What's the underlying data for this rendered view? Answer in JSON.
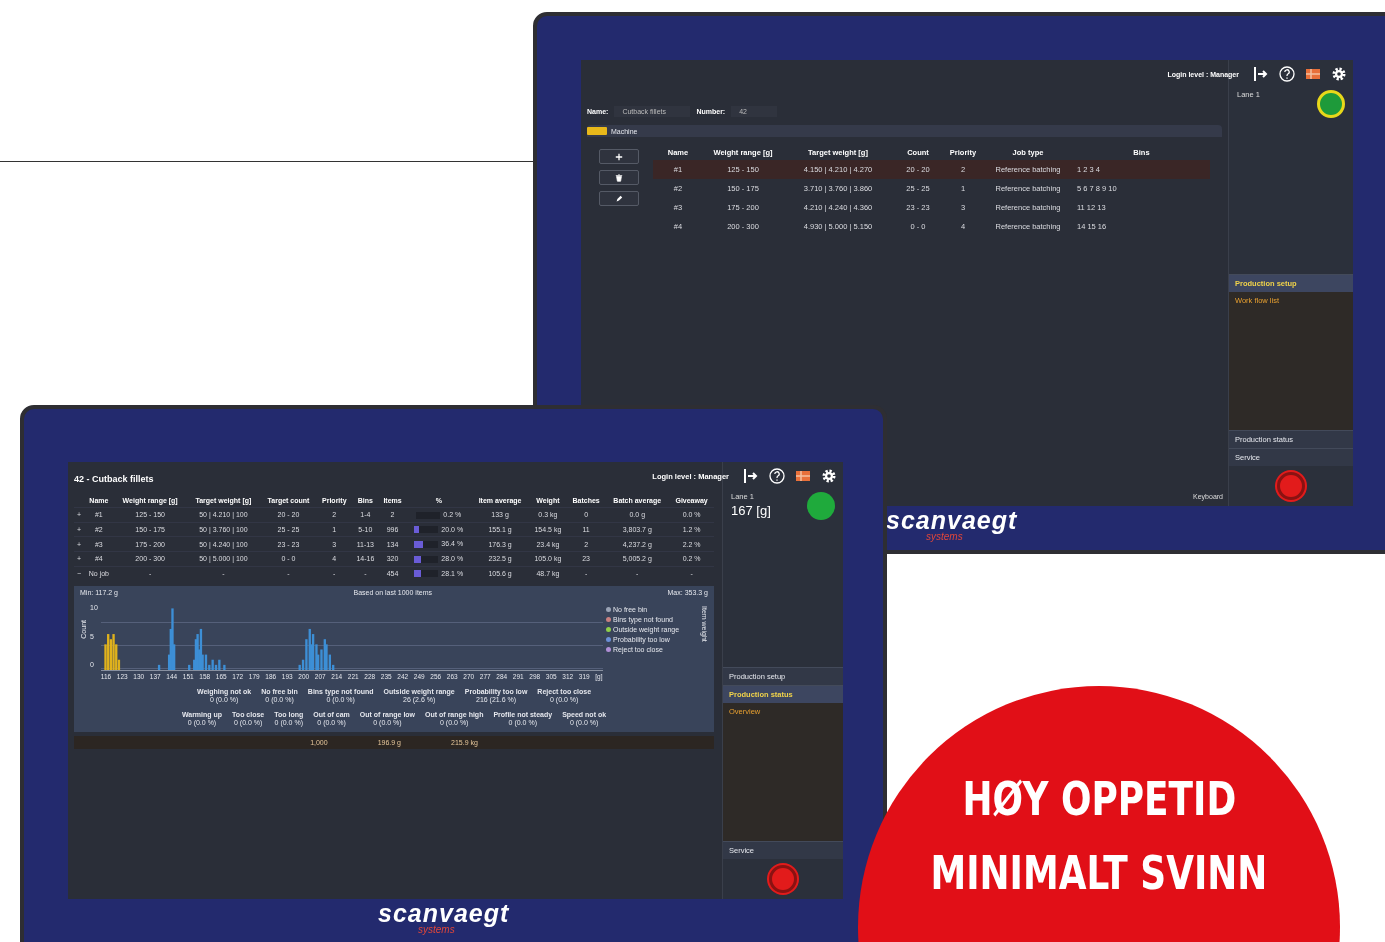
{
  "back_screen": {
    "login": "Login level : Manager",
    "name_label": "Name:",
    "name_value": "Cutback fillets",
    "number_label": "Number:",
    "number_value": "42",
    "section": "Machine",
    "columns": [
      "Name",
      "Weight range [g]",
      "Target weight [g]",
      "Count",
      "Priority",
      "Job type",
      "Bins"
    ],
    "rows": [
      {
        "selected": true,
        "cells": [
          "#1",
          "125 - 150",
          "4.150 | 4.210 | 4.270",
          "20 - 20",
          "2",
          "Reference batching",
          "1   2   3   4"
        ]
      },
      {
        "selected": false,
        "cells": [
          "#2",
          "150 - 175",
          "3.710 | 3.760 | 3.860",
          "25 - 25",
          "1",
          "Reference batching",
          "5   6   7   8   9   10"
        ]
      },
      {
        "selected": false,
        "cells": [
          "#3",
          "175 - 200",
          "4.210 | 4.240 | 4.360",
          "23 - 23",
          "3",
          "Reference batching",
          "11   12   13"
        ]
      },
      {
        "selected": false,
        "cells": [
          "#4",
          "200 - 300",
          "4.930 | 5.000 | 5.150",
          "0 - 0",
          "4",
          "Reference batching",
          "14   15   16"
        ]
      }
    ],
    "lane": "Lane 1",
    "panels": [
      {
        "label": "Production setup",
        "expanded": true,
        "items": [
          "Work flow list"
        ]
      },
      {
        "label": "Production status",
        "expanded": false
      },
      {
        "label": "Service",
        "expanded": false
      }
    ],
    "keyboard": "Keyboard",
    "logo": "scanvaegt",
    "logo_sub": "systems"
  },
  "front_screen": {
    "title": "42 - Cutback fillets",
    "login": "Login level : Manager",
    "columns": [
      "Name",
      "Weight range [g]",
      "Target weight [g]",
      "Target count",
      "Priority",
      "Bins",
      "Items",
      "%",
      "Item average",
      "Weight",
      "Batches",
      "Batch average",
      "Giveaway"
    ],
    "rows": [
      {
        "expander": "+",
        "level": 0.002,
        "cells": [
          "#1",
          "125 - 150",
          "50 | 4.210 | 100",
          "20 - 20",
          "2",
          "1-4",
          "2",
          "0.2 %",
          "133 g",
          "0.3 kg",
          "0",
          "0.0 g",
          "0.0 %"
        ]
      },
      {
        "expander": "+",
        "level": 0.2,
        "cells": [
          "#2",
          "150 - 175",
          "50 | 3.760 | 100",
          "25 - 25",
          "1",
          "5-10",
          "996",
          "20.0 %",
          "155.1 g",
          "154.5 kg",
          "11",
          "3,803.7 g",
          "1.2 %"
        ]
      },
      {
        "expander": "+",
        "level": 0.364,
        "cells": [
          "#3",
          "175 - 200",
          "50 | 4.240 | 100",
          "23 - 23",
          "3",
          "11-13",
          "134",
          "36.4 %",
          "176.3 g",
          "23.4 kg",
          "2",
          "4,237.2 g",
          "2.2 %"
        ]
      },
      {
        "expander": "+",
        "level": 0.28,
        "cells": [
          "#4",
          "200 - 300",
          "50 | 5.000 | 100",
          "0 - 0",
          "4",
          "14-16",
          "320",
          "28.0 %",
          "232.5 g",
          "105.0 kg",
          "23",
          "5,005.2 g",
          "0.2 %"
        ]
      },
      {
        "expander": "−",
        "level": 0.281,
        "cells": [
          "No job",
          "-",
          "-",
          "-",
          "-",
          "-",
          "454",
          "28.1 %",
          "105.6 g",
          "48.7 kg",
          "-",
          "-",
          "-"
        ]
      }
    ],
    "histogram": {
      "min": "Min: 117.2 g",
      "caption": "Based on last 1000 items",
      "max": "Max: 353.3 g",
      "ylabel": "Count",
      "yticks": [
        "10",
        "5",
        "0"
      ],
      "xticks": [
        "116",
        "123",
        "130",
        "137",
        "144",
        "151",
        "158",
        "165",
        "172",
        "179",
        "186",
        "193",
        "200",
        "207",
        "214",
        "221",
        "228",
        "235",
        "242",
        "249",
        "256",
        "263",
        "270",
        "277",
        "284",
        "291",
        "298",
        "305",
        "312",
        "319",
        "[g]"
      ],
      "legend": [
        {
          "label": "No free bin",
          "color": "#9aa3b5"
        },
        {
          "label": "Bins type not found",
          "color": "#c98080"
        },
        {
          "label": "Outside weight range",
          "color": "#8fcf4a"
        },
        {
          "label": "Probability too low",
          "color": "#6b8fd6"
        },
        {
          "label": "Reject too close",
          "color": "#b08fd6"
        }
      ],
      "side_label": "Item weight"
    },
    "stats": [
      [
        {
          "label": "Weighing not ok",
          "value": "0 (0.0 %)"
        },
        {
          "label": "No free bin",
          "value": "0 (0.0 %)"
        },
        {
          "label": "Bins type not found",
          "value": "0 (0.0 %)"
        },
        {
          "label": "Outside weight range",
          "value": "26 (2.6 %)"
        },
        {
          "label": "Probability too low",
          "value": "216 (21.6 %)"
        },
        {
          "label": "Reject too close",
          "value": "0 (0.0 %)"
        }
      ],
      [
        {
          "label": "Warming up",
          "value": "0 (0.0 %)"
        },
        {
          "label": "Too close",
          "value": "0 (0.0 %)"
        },
        {
          "label": "Too long",
          "value": "0 (0.0 %)"
        },
        {
          "label": "Out of cam",
          "value": "0 (0.0 %)"
        },
        {
          "label": "Out of range low",
          "value": "0 (0.0 %)"
        },
        {
          "label": "Out of range high",
          "value": "0 (0.0 %)"
        },
        {
          "label": "Profile not steady",
          "value": "0 (0.0 %)"
        },
        {
          "label": "Speed not ok",
          "value": "0 (0.0 %)"
        }
      ]
    ],
    "totals": [
      "1,000",
      "196.9 g",
      "215.9 kg"
    ],
    "lane": "Lane 1",
    "reading": "167 [g]",
    "panels": [
      {
        "label": "Production setup",
        "expanded": false
      },
      {
        "label": "Production status",
        "expanded": true,
        "items": [
          "Overview"
        ]
      },
      {
        "label": "Service",
        "expanded": false
      }
    ],
    "logo": "scanvaegt",
    "logo_sub": "systems"
  },
  "banner": {
    "lines": [
      "HØY OPPETID",
      "MINIMALT SVINN"
    ]
  }
}
